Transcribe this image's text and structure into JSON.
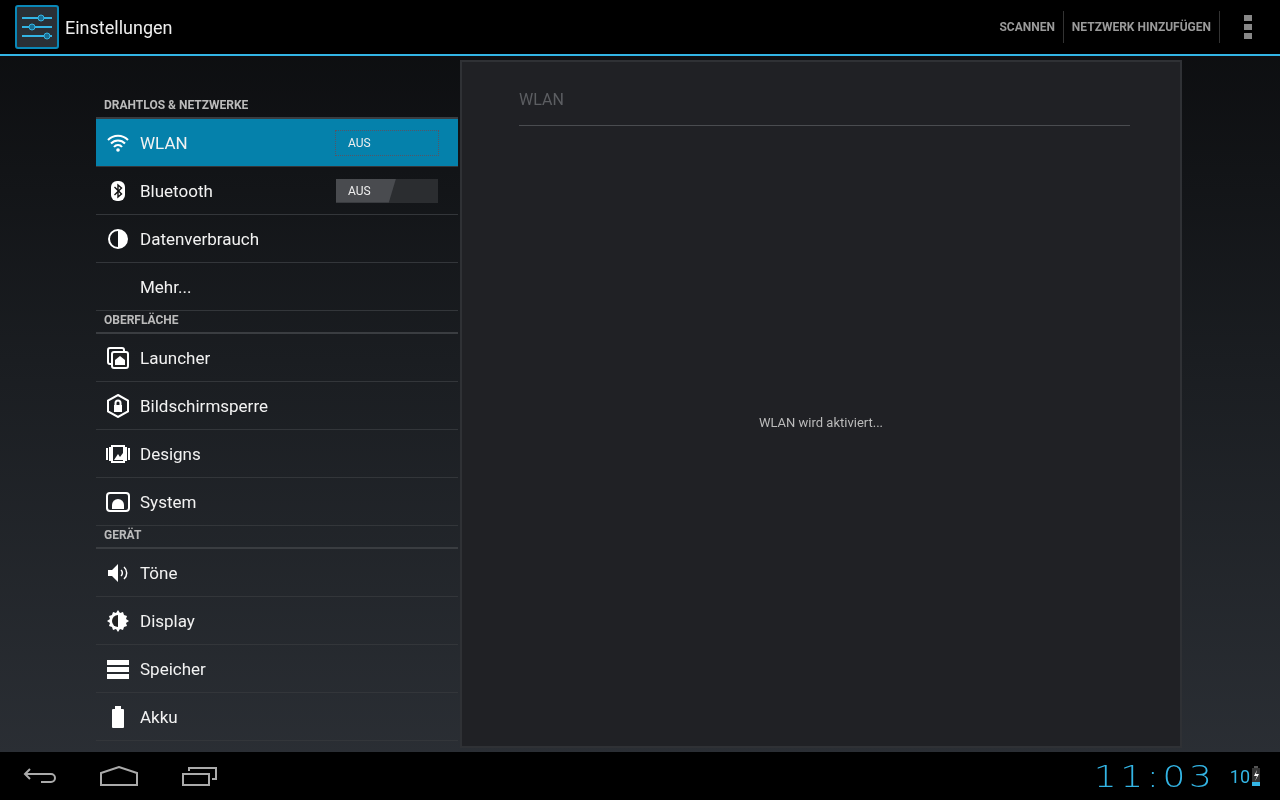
{
  "action_bar": {
    "title": "Einstellungen",
    "actions": [
      "SCANNEN",
      "NETZWERK HINZUFÜGEN"
    ]
  },
  "sidebar": {
    "sections": [
      {
        "header": "DRAHTLOS & NETZWERKE",
        "items": [
          {
            "kind": "wifi",
            "label": "WLAN",
            "selected": true,
            "toggle": {
              "label": "AUS",
              "on": false
            }
          },
          {
            "kind": "bluetooth",
            "label": "Bluetooth",
            "selected": false,
            "toggle": {
              "label": "AUS",
              "on": false
            }
          },
          {
            "kind": "data",
            "label": "Datenverbrauch",
            "selected": false
          },
          {
            "kind": "plain",
            "label": "Mehr...",
            "selected": false
          }
        ]
      },
      {
        "header": "OBERFLÄCHE",
        "items": [
          {
            "kind": "launcher",
            "label": "Launcher",
            "selected": false
          },
          {
            "kind": "lock",
            "label": "Bildschirmsperre",
            "selected": false
          },
          {
            "kind": "designs",
            "label": "Designs",
            "selected": false
          },
          {
            "kind": "system",
            "label": "System",
            "selected": false
          }
        ]
      },
      {
        "header": "GERÄT",
        "items": [
          {
            "kind": "sound",
            "label": "Töne",
            "selected": false
          },
          {
            "kind": "display",
            "label": "Display",
            "selected": false
          },
          {
            "kind": "storage",
            "label": "Speicher",
            "selected": false
          },
          {
            "kind": "battery",
            "label": "Akku",
            "selected": false
          }
        ]
      }
    ]
  },
  "detail": {
    "title": "WLAN",
    "message": "WLAN wird aktiviert..."
  },
  "system_bar": {
    "clock": "11:03",
    "battery_percent": "10"
  }
}
